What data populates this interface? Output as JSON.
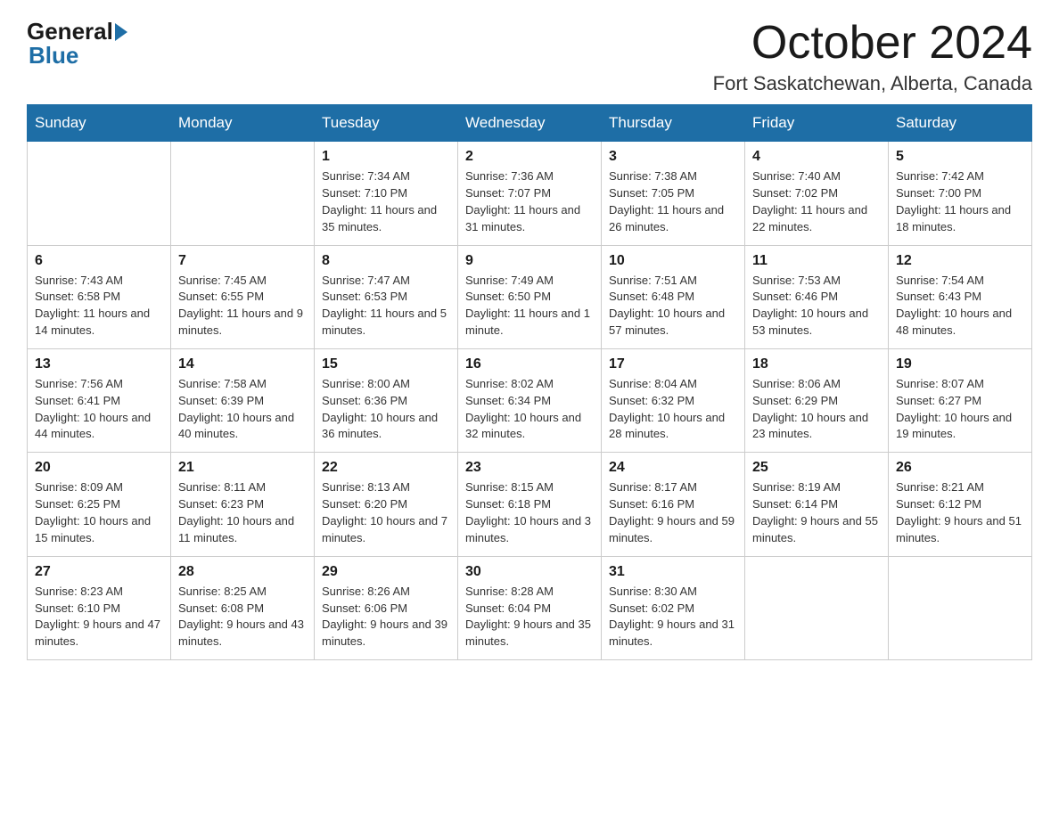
{
  "header": {
    "logo_general": "General",
    "logo_blue": "Blue",
    "month_year": "October 2024",
    "location": "Fort Saskatchewan, Alberta, Canada"
  },
  "days_of_week": [
    "Sunday",
    "Monday",
    "Tuesday",
    "Wednesday",
    "Thursday",
    "Friday",
    "Saturday"
  ],
  "weeks": [
    [
      {
        "day": "",
        "info": ""
      },
      {
        "day": "",
        "info": ""
      },
      {
        "day": "1",
        "info": "Sunrise: 7:34 AM\nSunset: 7:10 PM\nDaylight: 11 hours\nand 35 minutes."
      },
      {
        "day": "2",
        "info": "Sunrise: 7:36 AM\nSunset: 7:07 PM\nDaylight: 11 hours\nand 31 minutes."
      },
      {
        "day": "3",
        "info": "Sunrise: 7:38 AM\nSunset: 7:05 PM\nDaylight: 11 hours\nand 26 minutes."
      },
      {
        "day": "4",
        "info": "Sunrise: 7:40 AM\nSunset: 7:02 PM\nDaylight: 11 hours\nand 22 minutes."
      },
      {
        "day": "5",
        "info": "Sunrise: 7:42 AM\nSunset: 7:00 PM\nDaylight: 11 hours\nand 18 minutes."
      }
    ],
    [
      {
        "day": "6",
        "info": "Sunrise: 7:43 AM\nSunset: 6:58 PM\nDaylight: 11 hours\nand 14 minutes."
      },
      {
        "day": "7",
        "info": "Sunrise: 7:45 AM\nSunset: 6:55 PM\nDaylight: 11 hours\nand 9 minutes."
      },
      {
        "day": "8",
        "info": "Sunrise: 7:47 AM\nSunset: 6:53 PM\nDaylight: 11 hours\nand 5 minutes."
      },
      {
        "day": "9",
        "info": "Sunrise: 7:49 AM\nSunset: 6:50 PM\nDaylight: 11 hours\nand 1 minute."
      },
      {
        "day": "10",
        "info": "Sunrise: 7:51 AM\nSunset: 6:48 PM\nDaylight: 10 hours\nand 57 minutes."
      },
      {
        "day": "11",
        "info": "Sunrise: 7:53 AM\nSunset: 6:46 PM\nDaylight: 10 hours\nand 53 minutes."
      },
      {
        "day": "12",
        "info": "Sunrise: 7:54 AM\nSunset: 6:43 PM\nDaylight: 10 hours\nand 48 minutes."
      }
    ],
    [
      {
        "day": "13",
        "info": "Sunrise: 7:56 AM\nSunset: 6:41 PM\nDaylight: 10 hours\nand 44 minutes."
      },
      {
        "day": "14",
        "info": "Sunrise: 7:58 AM\nSunset: 6:39 PM\nDaylight: 10 hours\nand 40 minutes."
      },
      {
        "day": "15",
        "info": "Sunrise: 8:00 AM\nSunset: 6:36 PM\nDaylight: 10 hours\nand 36 minutes."
      },
      {
        "day": "16",
        "info": "Sunrise: 8:02 AM\nSunset: 6:34 PM\nDaylight: 10 hours\nand 32 minutes."
      },
      {
        "day": "17",
        "info": "Sunrise: 8:04 AM\nSunset: 6:32 PM\nDaylight: 10 hours\nand 28 minutes."
      },
      {
        "day": "18",
        "info": "Sunrise: 8:06 AM\nSunset: 6:29 PM\nDaylight: 10 hours\nand 23 minutes."
      },
      {
        "day": "19",
        "info": "Sunrise: 8:07 AM\nSunset: 6:27 PM\nDaylight: 10 hours\nand 19 minutes."
      }
    ],
    [
      {
        "day": "20",
        "info": "Sunrise: 8:09 AM\nSunset: 6:25 PM\nDaylight: 10 hours\nand 15 minutes."
      },
      {
        "day": "21",
        "info": "Sunrise: 8:11 AM\nSunset: 6:23 PM\nDaylight: 10 hours\nand 11 minutes."
      },
      {
        "day": "22",
        "info": "Sunrise: 8:13 AM\nSunset: 6:20 PM\nDaylight: 10 hours\nand 7 minutes."
      },
      {
        "day": "23",
        "info": "Sunrise: 8:15 AM\nSunset: 6:18 PM\nDaylight: 10 hours\nand 3 minutes."
      },
      {
        "day": "24",
        "info": "Sunrise: 8:17 AM\nSunset: 6:16 PM\nDaylight: 9 hours\nand 59 minutes."
      },
      {
        "day": "25",
        "info": "Sunrise: 8:19 AM\nSunset: 6:14 PM\nDaylight: 9 hours\nand 55 minutes."
      },
      {
        "day": "26",
        "info": "Sunrise: 8:21 AM\nSunset: 6:12 PM\nDaylight: 9 hours\nand 51 minutes."
      }
    ],
    [
      {
        "day": "27",
        "info": "Sunrise: 8:23 AM\nSunset: 6:10 PM\nDaylight: 9 hours\nand 47 minutes."
      },
      {
        "day": "28",
        "info": "Sunrise: 8:25 AM\nSunset: 6:08 PM\nDaylight: 9 hours\nand 43 minutes."
      },
      {
        "day": "29",
        "info": "Sunrise: 8:26 AM\nSunset: 6:06 PM\nDaylight: 9 hours\nand 39 minutes."
      },
      {
        "day": "30",
        "info": "Sunrise: 8:28 AM\nSunset: 6:04 PM\nDaylight: 9 hours\nand 35 minutes."
      },
      {
        "day": "31",
        "info": "Sunrise: 8:30 AM\nSunset: 6:02 PM\nDaylight: 9 hours\nand 31 minutes."
      },
      {
        "day": "",
        "info": ""
      },
      {
        "day": "",
        "info": ""
      }
    ]
  ]
}
